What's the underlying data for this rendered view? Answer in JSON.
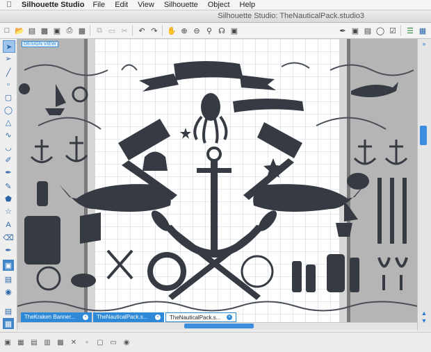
{
  "menubar": {
    "app_name": "Silhouette Studio",
    "items": [
      "File",
      "Edit",
      "View",
      "Silhouette",
      "Object",
      "Help"
    ]
  },
  "window": {
    "title": "Silhouette Studio: TheNauticalPack.studio3"
  },
  "toolbar": {
    "icons": [
      "new-document-icon",
      "open-icon",
      "open-recent-icon",
      "save-icon",
      "save-as-icon",
      "print-icon",
      "print-cut-icon",
      "copy-icon",
      "paste-icon",
      "cut-icon",
      "undo-icon",
      "redo-icon",
      "pan-icon",
      "zoom-in-icon",
      "zoom-out-icon",
      "zoom-select-icon",
      "fit-to-page-icon",
      "eraser-icon",
      "design-page-settings-icon",
      "cut-settings-icon",
      "send-to-silhouette-icon",
      "cut-icon",
      "library-icon",
      "menu-icon"
    ]
  },
  "canvas": {
    "badge": "DESIGN VIEW"
  },
  "tabs": [
    {
      "label": "TheKraken Banner...",
      "active": false
    },
    {
      "label": "TheNauticalPack.s...",
      "active": false
    },
    {
      "label": "TheNauticalPack.s...",
      "active": true
    }
  ],
  "colors": {
    "accent": "#2e8ad8",
    "shape_fill": "#363b43",
    "grid_line": "#b8c7d6"
  }
}
